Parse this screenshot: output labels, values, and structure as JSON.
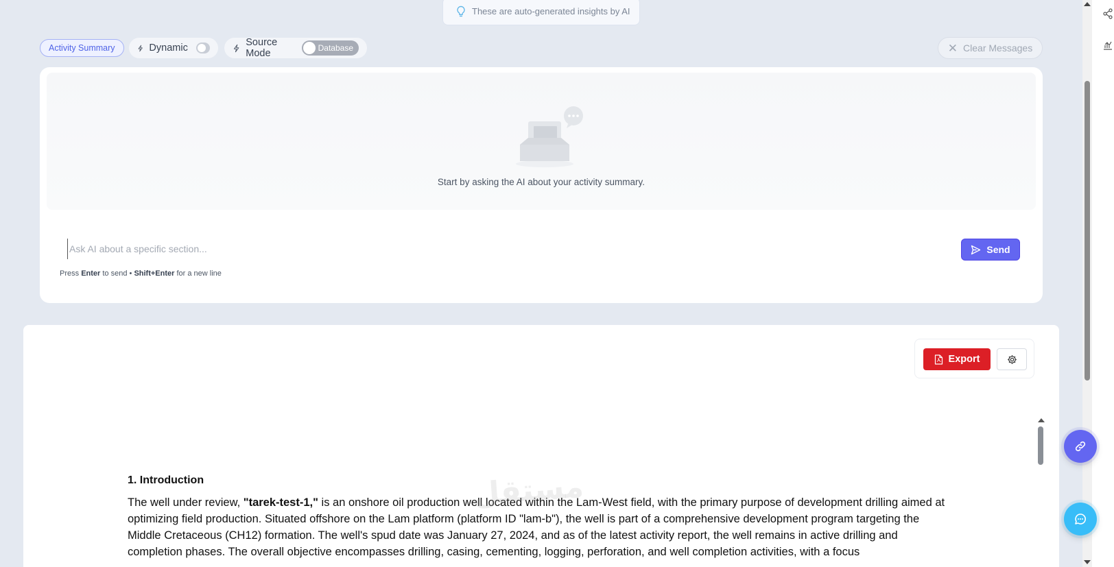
{
  "insight_banner": {
    "text": "These are auto-generated insights by AI"
  },
  "toolbar": {
    "activity_summary_label": "Activity Summary",
    "dynamic_label": "Dynamic",
    "source_mode_label": "Source Mode",
    "source_mode_value": "Database",
    "clear_messages_label": "Clear Messages"
  },
  "chat": {
    "empty_message": "Start by asking the AI about your activity summary.",
    "input_placeholder": "Ask AI about a specific section...",
    "input_value": "",
    "send_label": "Send",
    "hint_press": "Press",
    "hint_enter": "Enter",
    "hint_to_send": "to send •",
    "hint_shift_enter": "Shift+Enter",
    "hint_new_line": "for a new line"
  },
  "report": {
    "export_label": "Export",
    "section_title": "1. Introduction",
    "para_prefix": "The well under review, ",
    "para_well": "\"tarek-test-1,\"",
    "para_body": " is an onshore oil production well located within the Lam-West field, with the primary purpose of development drilling aimed at optimizing field production. Situated offshore on the Lam platform (platform ID \"lam-b\"), the well is part of a comprehensive development program targeting the Middle Cretaceous (CH12) formation. The well's spud date was January 27, 2024, and as of the latest activity report, the well remains in active drilling and completion phases. The overall objective encompasses drilling, casing, cementing, logging, perforation, and well completion activities, with a focus"
  },
  "watermark": {
    "text": "مستقل"
  },
  "icons": {
    "insight": "lightbulb-icon",
    "dynamic": "bolt-icon",
    "source_mode": "bolt-icon",
    "clear": "close-icon",
    "send": "send-icon",
    "export": "pdf-file-icon",
    "settings": "gear-icon",
    "fab_link": "link-icon",
    "fab_chat": "chat-icon",
    "share": "share-icon",
    "chart_tool": "chart-icon"
  },
  "colors": {
    "accent": "#6366f1",
    "export_red": "#dc1f26",
    "chat_fab": "#38bdf8",
    "background": "#e4e9f1"
  }
}
